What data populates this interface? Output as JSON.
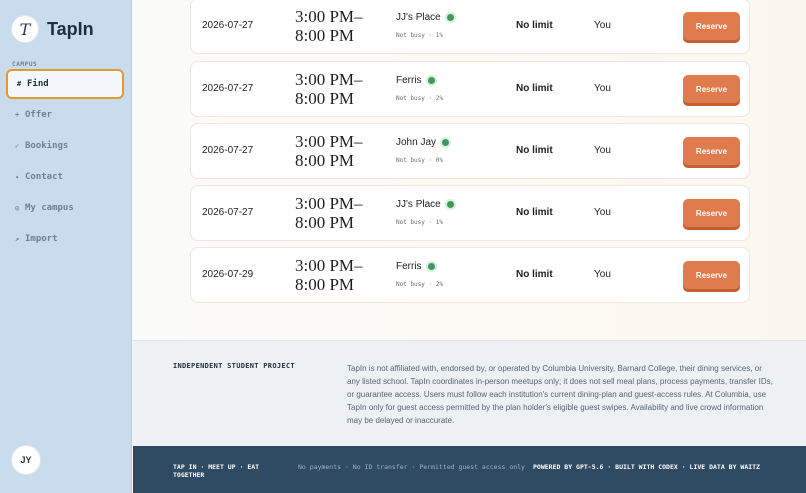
{
  "brand": {
    "logo_letter": "T",
    "name": "TapIn"
  },
  "sidebar": {
    "section_label": "CAMPUS",
    "items": [
      {
        "icon": "#",
        "label": "Find"
      },
      {
        "icon": "+",
        "label": "Offer"
      },
      {
        "icon": "✓",
        "label": "Bookings"
      },
      {
        "icon": "✦",
        "label": "Contact"
      },
      {
        "icon": "◎",
        "label": "My campus"
      },
      {
        "icon": "↗",
        "label": "Import"
      }
    ],
    "active": "Find",
    "avatar": "JY"
  },
  "listings": [
    {
      "date": "2026-07-27",
      "time_start": "3:00 PM–",
      "time_end": "8:00 PM",
      "place": "JJ's Place",
      "busy": "Not busy · 1%",
      "limit": "No limit",
      "who": "You",
      "action": "Reserve"
    },
    {
      "date": "2026-07-27",
      "time_start": "3:00 PM–",
      "time_end": "8:00 PM",
      "place": "Ferris",
      "busy": "Not busy · 2%",
      "limit": "No limit",
      "who": "You",
      "action": "Reserve"
    },
    {
      "date": "2026-07-27",
      "time_start": "3:00 PM–",
      "time_end": "8:00 PM",
      "place": "John Jay",
      "busy": "Not busy · 0%",
      "limit": "No limit",
      "who": "You",
      "action": "Reserve"
    },
    {
      "date": "2026-07-27",
      "time_start": "3:00 PM–",
      "time_end": "8:00 PM",
      "place": "JJ's Place",
      "busy": "Not busy · 1%",
      "limit": "No limit",
      "who": "You",
      "action": "Reserve"
    },
    {
      "date": "2026-07-29",
      "time_start": "3:00 PM–",
      "time_end": "8:00 PM",
      "place": "Ferris",
      "busy": "Not busy · 2%",
      "limit": "No limit",
      "who": "You",
      "action": "Reserve"
    }
  ],
  "disclaimer": {
    "heading": "INDEPENDENT STUDENT PROJECT",
    "body": "TapIn is not affiliated with, endorsed by, or operated by Columbia University, Barnard College, their dining services, or any listed school. TapIn coordinates in-person meetups only; it does not sell meal plans, process payments, transfer IDs, or guarantee access. Users must follow each institution's current dining-plan and guest-access rules. At Columbia, use TapIn only for guest access permitted by the plan holder's eligible guest swipes. Availability and live crowd information may be delayed or inaccurate."
  },
  "footer": {
    "tagline": "TAP IN · MEET UP · EAT TOGETHER",
    "notice": "No payments · No ID transfer · Permitted guest access only",
    "credits": "POWERED BY GPT-5.6 · BUILT WITH CODEX · LIVE DATA BY WAITZ"
  },
  "colors": {
    "sidebar_bg": "#c9dced",
    "accent_orange": "#df7b4d",
    "active_border": "#e09a2e",
    "status_green": "#3f9a5a",
    "footer_bg": "#2f4a63"
  }
}
